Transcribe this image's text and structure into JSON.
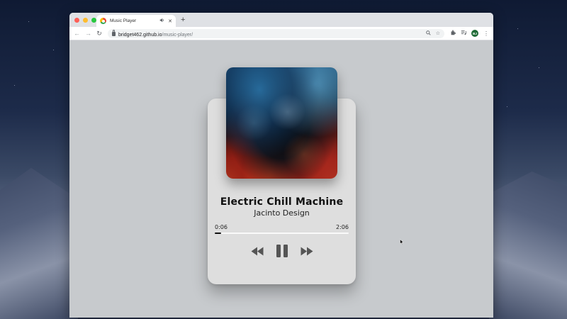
{
  "browser": {
    "tab_title": "Music Player",
    "tab_audio_icon": "speaker-icon",
    "tab_close": "✕",
    "new_tab": "+",
    "url_host": "bridget462.github.io",
    "url_path": "/music-player/",
    "profile_initials": "BJ"
  },
  "player": {
    "song_title": "Electric Chill Machine",
    "artist": "Jacinto Design",
    "current_time": "0:06",
    "total_time": "2:06",
    "progress": 0.048,
    "state": "playing",
    "controls": {
      "previous": "rewind-icon",
      "play_pause": "pause-icon",
      "next": "fast-forward-icon"
    }
  },
  "colors": {
    "card_bg": "#dedede",
    "page_bg": "#c7cacd",
    "text": "#111111",
    "progress_fill": "#111111",
    "progress_track": "#fafafa",
    "control_fill": "#555555"
  }
}
